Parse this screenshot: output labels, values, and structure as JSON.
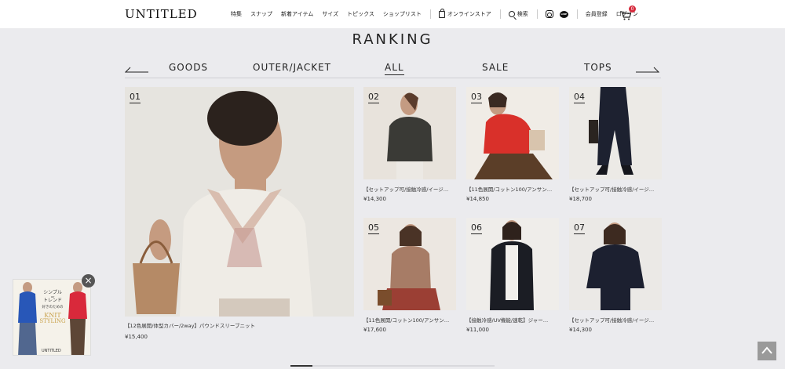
{
  "header": {
    "logo": "UNTITLED",
    "nav": [
      "特集",
      "スナップ",
      "新着アイテム",
      "サイズ",
      "トピックス",
      "ショップリスト"
    ],
    "online_store": "オンラインストア",
    "search": "検索",
    "register": "会員登録",
    "login": "ログイン",
    "cart_count": "0"
  },
  "ranking": {
    "title": "RANKING",
    "tabs": [
      "GOODS",
      "OUTER/JACKET",
      "ALL",
      "SALE",
      "TOPS"
    ],
    "active_tab": "ALL"
  },
  "products": [
    {
      "rank": "01",
      "name": "【12色展開/体型カバー/2way】パウンドスリーブニット",
      "price": "¥15,400",
      "colors": [
        "#e6e4df",
        "#efece6",
        "#d4c9bd"
      ]
    },
    {
      "rank": "02",
      "name": "【セットアップ可/接触冷感/イージ…",
      "price": "¥14,300",
      "colors": [
        "#e8e3dc",
        "#3a3a36"
      ]
    },
    {
      "rank": "03",
      "name": "【11色展開/コットン100/アンサン…",
      "price": "¥14,850",
      "colors": [
        "#f0ece6",
        "#d9302a"
      ]
    },
    {
      "rank": "04",
      "name": "【セットアップ可/接触冷感/イージ…",
      "price": "¥18,700",
      "colors": [
        "#eceae6",
        "#1d2130"
      ]
    },
    {
      "rank": "05",
      "name": "【11色展開/コットン100/アンサン…",
      "price": "¥17,600",
      "colors": [
        "#ece7e1",
        "#a77c66"
      ]
    },
    {
      "rank": "06",
      "name": "【接触冷感/UV機能/速乾】ジャー…",
      "price": "¥11,000",
      "colors": [
        "#efedea",
        "#1b1d24"
      ]
    },
    {
      "rank": "07",
      "name": "【セットアップ可/接触冷感/イージ…",
      "price": "¥14,300",
      "colors": [
        "#ebe9e6",
        "#1c2030"
      ]
    }
  ],
  "promo": {
    "line1": "シンプル",
    "line2": "or",
    "line3": "トレンド",
    "line4": "好きのための",
    "line5": "KNIT",
    "line6": "STYLING",
    "brand": "UNTITLED",
    "close": "×"
  },
  "page_top": "▲"
}
